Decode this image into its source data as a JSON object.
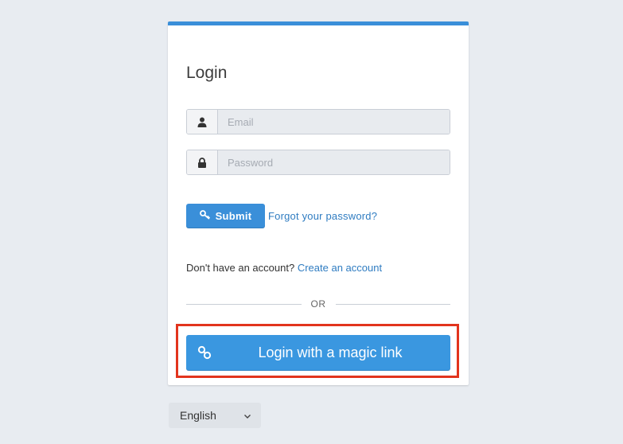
{
  "login": {
    "title": "Login",
    "email_placeholder": "Email",
    "password_placeholder": "Password",
    "submit_label": "Submit",
    "forgot_label": "Forgot your password?",
    "no_account_text": "Don't have an account?",
    "create_account_label": "Create an account",
    "or_text": "OR",
    "magic_link_label": "Login with a magic link"
  },
  "language": {
    "selected": "English"
  },
  "icons": {
    "email": "user-icon",
    "password": "lock-icon",
    "submit": "key-icon",
    "magic": "link-icon",
    "language": "chevron-down-icon"
  },
  "colors": {
    "accent": "#3a8fd9",
    "highlight": "#e2341d",
    "background": "#e8ecf1"
  }
}
